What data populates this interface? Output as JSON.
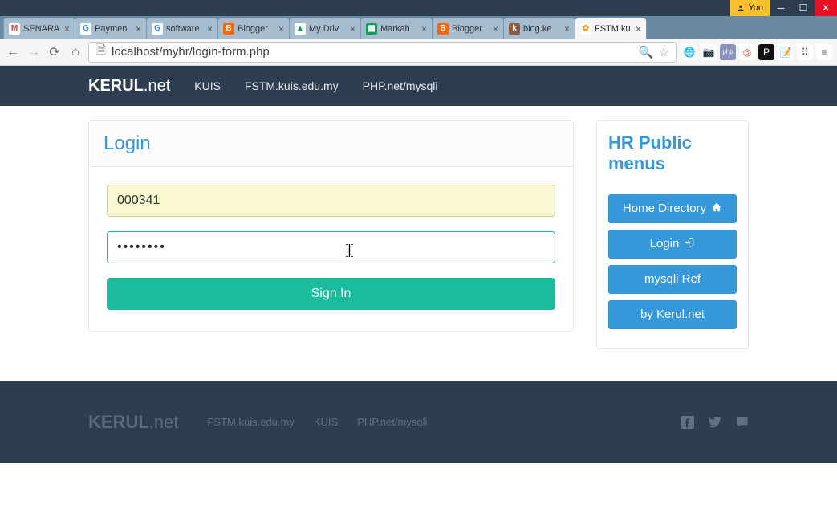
{
  "titlebar": {
    "you_label": "You"
  },
  "tabs": [
    {
      "title": "SENARA",
      "fav_bg": "#fff",
      "fav_text": "M",
      "fav_color": "#d93025"
    },
    {
      "title": "Paymen",
      "fav_bg": "#fff",
      "fav_text": "G",
      "fav_color": "#4285f4"
    },
    {
      "title": "software",
      "fav_bg": "#fff",
      "fav_text": "G",
      "fav_color": "#4285f4"
    },
    {
      "title": "Blogger",
      "fav_bg": "#ff6600",
      "fav_text": "B",
      "fav_color": "#fff"
    },
    {
      "title": "My Driv",
      "fav_bg": "#fff",
      "fav_text": "▲",
      "fav_color": "#0f9d58"
    },
    {
      "title": "Markah",
      "fav_bg": "#0f9d58",
      "fav_text": "▦",
      "fav_color": "#fff"
    },
    {
      "title": "Blogger",
      "fav_bg": "#ff6600",
      "fav_text": "B",
      "fav_color": "#fff"
    },
    {
      "title": "blog.ke",
      "fav_bg": "#8a5a44",
      "fav_text": "k",
      "fav_color": "#fff"
    },
    {
      "title": "FSTM.ku",
      "fav_bg": "#fff",
      "fav_text": "✿",
      "fav_color": "#f39c12"
    }
  ],
  "url": "localhost/myhr/login-form.php",
  "extensions": [
    {
      "name": "translate",
      "bg": "#fff",
      "text": "🌐",
      "color": "#4285f4"
    },
    {
      "name": "camera",
      "bg": "#fff",
      "text": "📷",
      "color": "#555"
    },
    {
      "name": "php",
      "bg": "#8892bf",
      "text": "php",
      "color": "#fff"
    },
    {
      "name": "circle",
      "bg": "#fff",
      "text": "◎",
      "color": "#e74c3c"
    },
    {
      "name": "p",
      "bg": "#111",
      "text": "P",
      "color": "#fff"
    },
    {
      "name": "note",
      "bg": "#fff",
      "text": "📝",
      "color": "#f39c12"
    },
    {
      "name": "grid",
      "bg": "#fff",
      "text": "⠿",
      "color": "#555"
    },
    {
      "name": "menu",
      "bg": "#fff",
      "text": "≡",
      "color": "#555"
    }
  ],
  "topnav": {
    "brand_bold": "KERUL",
    "brand_light": ".net",
    "links": [
      "KUIS",
      "FSTM.kuis.edu.my",
      "PHP.net/mysqli"
    ]
  },
  "login_panel": {
    "heading": "Login",
    "username_value": "000341",
    "password_value": "••••••••",
    "submit_label": "Sign In"
  },
  "side_panel": {
    "heading": "HR Public menus",
    "buttons": [
      {
        "label": "Home Directory",
        "icon": "home"
      },
      {
        "label": "Login",
        "icon": "login"
      },
      {
        "label": "mysqli Ref",
        "icon": ""
      },
      {
        "label": "by Kerul.net",
        "icon": ""
      }
    ]
  },
  "footer": {
    "brand_bold": "KERUL",
    "brand_light": ".net",
    "links": [
      "FSTM.kuis.edu.my",
      "KUIS",
      "PHP.net/mysqli"
    ]
  }
}
